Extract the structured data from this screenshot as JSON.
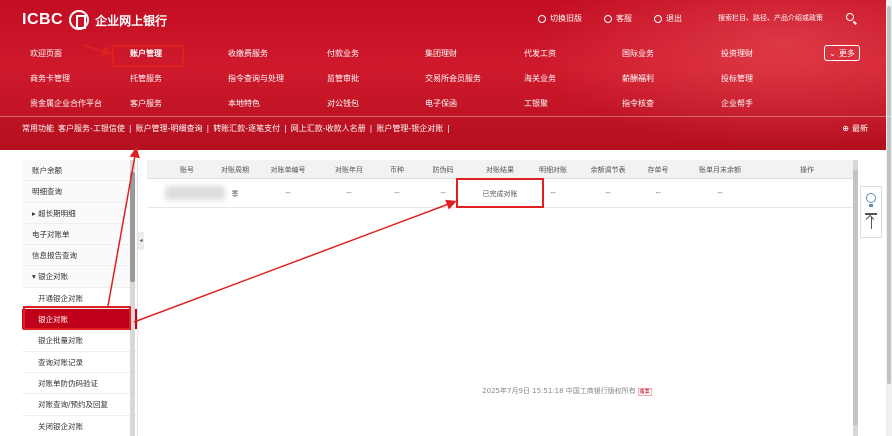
{
  "header": {
    "logo_text": "ICBC",
    "logo_sub": "企业网上银行",
    "links": [
      {
        "label": "切换旧版",
        "icon": "switch-icon"
      },
      {
        "label": "客服",
        "icon": "headset-icon"
      },
      {
        "label": "退出",
        "icon": "power-icon"
      }
    ],
    "search_placeholder": "搜索栏目、路径、产品介绍或政策",
    "more_label": "更多"
  },
  "menu": [
    [
      "欢迎页面",
      "账户管理",
      "收缴费服务",
      "付款业务",
      "集团理财",
      "代发工资",
      "国际业务",
      "投资理财"
    ],
    [
      "商务卡管理",
      "托管服务",
      "指令查询与处理",
      "监管审批",
      "交易所会员服务",
      "海关业务",
      "薪酬福利",
      "投标管理"
    ],
    [
      "贵金属企业合作平台",
      "客户服务",
      "本地特色",
      "对公钱包",
      "电子保函",
      "工银聚",
      "指令核查",
      "企业帮手"
    ]
  ],
  "common": {
    "label": "常用功能",
    "items": [
      "客户服务-工银信使",
      "账户管理-明细查询",
      "转账汇款-逐笔支付",
      "网上汇款-收款人名册",
      "账户管理-银企对账"
    ],
    "latest_label": "最新"
  },
  "sidebar": [
    {
      "label": "账户余额",
      "sub": false,
      "active": false
    },
    {
      "label": "明细查询",
      "sub": false,
      "active": false
    },
    {
      "label": "▸ 超长期明细",
      "sub": false,
      "active": false
    },
    {
      "label": "电子对账单",
      "sub": false,
      "active": false
    },
    {
      "label": "信息报告查询",
      "sub": false,
      "active": false
    },
    {
      "label": "▾ 银企对账",
      "sub": false,
      "active": false
    },
    {
      "label": "开通银企对账",
      "sub": true,
      "active": false
    },
    {
      "label": "银企对账",
      "sub": true,
      "active": true
    },
    {
      "label": "银企批量对账",
      "sub": true,
      "active": false
    },
    {
      "label": "查询对账记录",
      "sub": true,
      "active": false
    },
    {
      "label": "对账单防伪码验证",
      "sub": true,
      "active": false
    },
    {
      "label": "对账查询/预约及回复",
      "sub": true,
      "active": false
    },
    {
      "label": "关闭银企对账",
      "sub": true,
      "active": false
    }
  ],
  "table": {
    "columns": [
      "账号",
      "对账周期",
      "对账单编号",
      "对账年月",
      "币种",
      "防伪码",
      "对账结果",
      "明细对账",
      "余额调节表",
      "存单号",
      "账单月末余额",
      "操作"
    ],
    "rows": [
      [
        "",
        "季",
        "--",
        "--",
        "--",
        "--",
        "已完成对账",
        "--",
        "--",
        "--",
        "--",
        ""
      ]
    ]
  },
  "footer": {
    "text": "2025年7月9日 15:51:18   中国工商银行版权所有",
    "tag": "备案"
  },
  "colors": {
    "brand_red": "#c30d23",
    "highlight": "#e02020",
    "active_side": "#c0001a"
  }
}
